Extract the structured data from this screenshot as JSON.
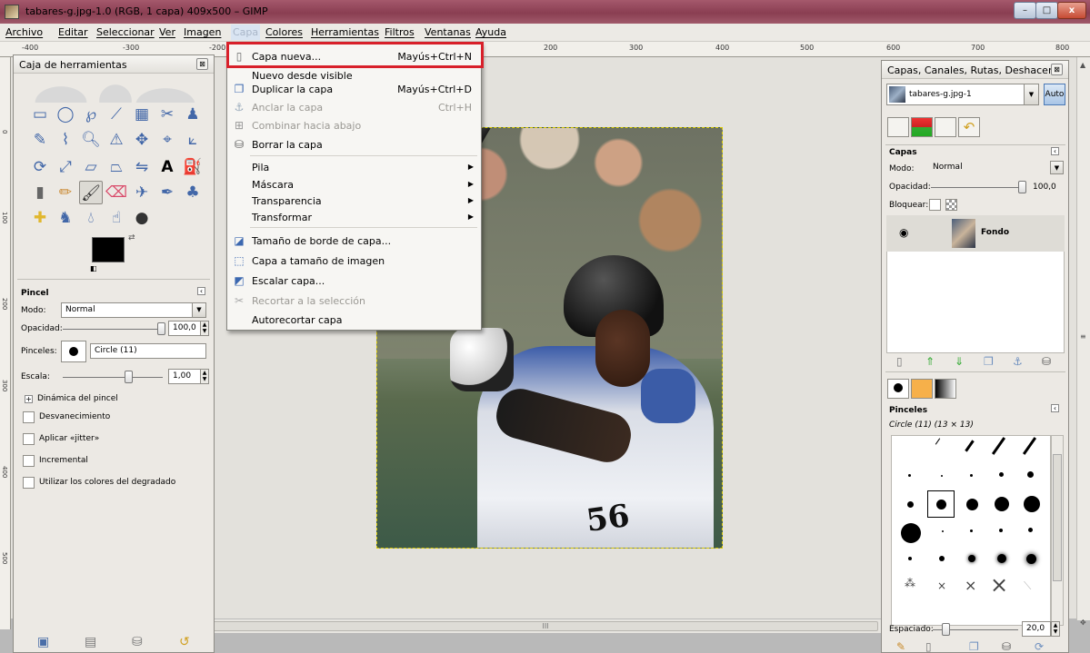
{
  "window": {
    "title": "tabares-g.jpg-1.0 (RGB, 1 capa) 409x500 – GIMP",
    "min_label": "–",
    "max_label": "□",
    "close_label": "x"
  },
  "menubar": {
    "items": [
      "Archivo",
      "Editar",
      "Seleccionar",
      "Ver",
      "Imagen",
      "Capa",
      "Colores",
      "Herramientas",
      "Filtros",
      "Ventanas",
      "Ayuda"
    ]
  },
  "ruler": {
    "top_labels": [
      "-400",
      "-300",
      "-200",
      "200",
      "300",
      "400",
      "500",
      "600",
      "700",
      "800"
    ],
    "left_labels": [
      "0",
      "100",
      "200",
      "300",
      "400",
      "500"
    ]
  },
  "toolbox": {
    "title": "Caja de herramientas",
    "tool_options": {
      "title": "Pincel",
      "mode_label": "Modo:",
      "mode_value": "Normal",
      "opacity_label": "Opacidad:",
      "opacity_value": "100,0",
      "brushes_label": "Pinceles:",
      "brush_value": "Circle (11)",
      "scale_label": "Escala:",
      "scale_value": "1,00",
      "dynamics_label": "Dinámica del pincel",
      "checks": [
        "Desvanecimiento",
        "Aplicar «jitter»",
        "Incremental",
        "Utilizar los colores del degradado"
      ]
    }
  },
  "layer_menu": {
    "items": [
      {
        "label": "Capa nueva...",
        "shortcut": "Mayús+Ctrl+N",
        "icon": "new-layer-icon",
        "disabled": false
      },
      {
        "label": "Nuevo desde visible",
        "shortcut": "",
        "icon": "",
        "disabled": false
      },
      {
        "label": "Duplicar la capa",
        "shortcut": "Mayús+Ctrl+D",
        "icon": "duplicate-icon",
        "disabled": false
      },
      {
        "label": "Anclar la capa",
        "shortcut": "Ctrl+H",
        "icon": "anchor-icon",
        "disabled": true
      },
      {
        "label": "Combinar hacia abajo",
        "shortcut": "",
        "icon": "merge-icon",
        "disabled": true
      },
      {
        "label": "Borrar la capa",
        "shortcut": "",
        "icon": "trash-icon",
        "disabled": false
      },
      {
        "label": "Pila",
        "submenu": true
      },
      {
        "label": "Máscara",
        "submenu": true
      },
      {
        "label": "Transparencia",
        "submenu": true
      },
      {
        "label": "Transformar",
        "submenu": true
      },
      {
        "label": "Tamaño de borde de capa...",
        "icon": "layer-border-size-icon"
      },
      {
        "label": "Capa a tamaño de imagen",
        "icon": "layer-to-image-icon"
      },
      {
        "label": "Escalar capa...",
        "icon": "scale-icon"
      },
      {
        "label": "Recortar a la selección",
        "icon": "crop-icon",
        "disabled": true
      },
      {
        "label": "Autorecortar capa",
        "icon": ""
      }
    ]
  },
  "dock": {
    "title": "Capas, Canales, Rutas, Deshacer - ...",
    "image_name": "tabares-g.jpg-1",
    "auto_label": "Auto",
    "layers": {
      "title": "Capas",
      "mode_label": "Modo:",
      "mode_value": "Normal",
      "opacity_label": "Opacidad:",
      "opacity_value": "100,0",
      "lock_label": "Bloquear:",
      "layer_name": "Fondo"
    },
    "brushes": {
      "title": "Pinceles",
      "subtitle": "Circle (11) (13 × 13)",
      "spacing_label": "Espaciado:",
      "spacing_value": "20,0"
    }
  },
  "photo": {
    "jersey_number": "56"
  },
  "scrollbar": {
    "grip": "III"
  }
}
